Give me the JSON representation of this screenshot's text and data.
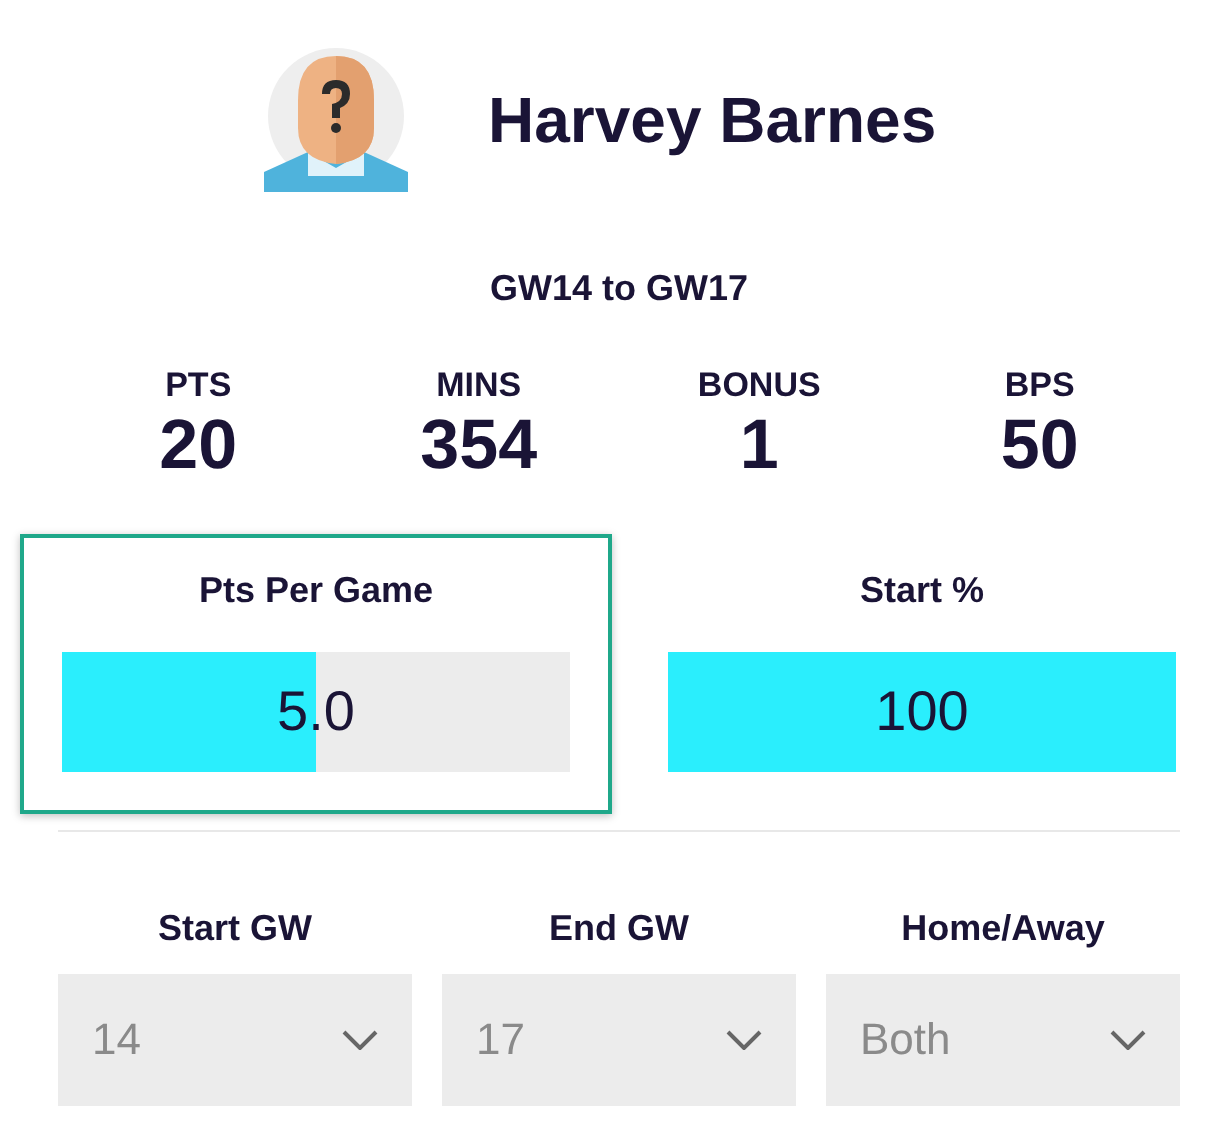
{
  "player": {
    "name": "Harvey Barnes"
  },
  "range": "GW14 to GW17",
  "stats": [
    {
      "label": "PTS",
      "value": "20"
    },
    {
      "label": "MINS",
      "value": "354"
    },
    {
      "label": "BONUS",
      "value": "1"
    },
    {
      "label": "BPS",
      "value": "50"
    }
  ],
  "meters": [
    {
      "label": "Pts Per Game",
      "reading": "5.0",
      "level": 0.5,
      "highlighted": true
    },
    {
      "label": "Start %",
      "reading": "100",
      "level": 1,
      "highlighted": false
    }
  ],
  "filters": [
    {
      "label": "Start GW",
      "value": "14"
    },
    {
      "label": "End GW",
      "value": "17"
    },
    {
      "label": "Home/Away",
      "value": "Both"
    }
  ]
}
